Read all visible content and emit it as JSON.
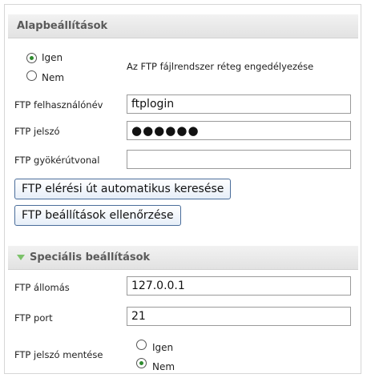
{
  "basic": {
    "title": "Alapbeállítások",
    "radio_yes": "Igen",
    "radio_no": "Nem",
    "enable_desc": "Az FTP fájlrendszer réteg engedélyezése",
    "username_label": "FTP felhasználónév",
    "username_value": "ftplogin",
    "password_label": "FTP jelszó",
    "password_value": "●●●●●●",
    "root_label": "FTP gyökérútvonal",
    "root_value": "",
    "autodetect_button": "FTP elérési út automatikus keresése",
    "verify_button": "FTP beállítások ellenőrzése"
  },
  "special": {
    "title": "Speciális beállítások",
    "host_label": "FTP állomás",
    "host_value": "127.0.0.1",
    "port_label": "FTP port",
    "port_value": "21",
    "save_pw_label": "FTP jelszó mentése",
    "radio_yes": "Igen",
    "radio_no": "Nem"
  },
  "colors": {
    "radio_selected": "#2e8b2e",
    "triangle": "#7cc26a",
    "button_border": "#4a6d9a"
  }
}
